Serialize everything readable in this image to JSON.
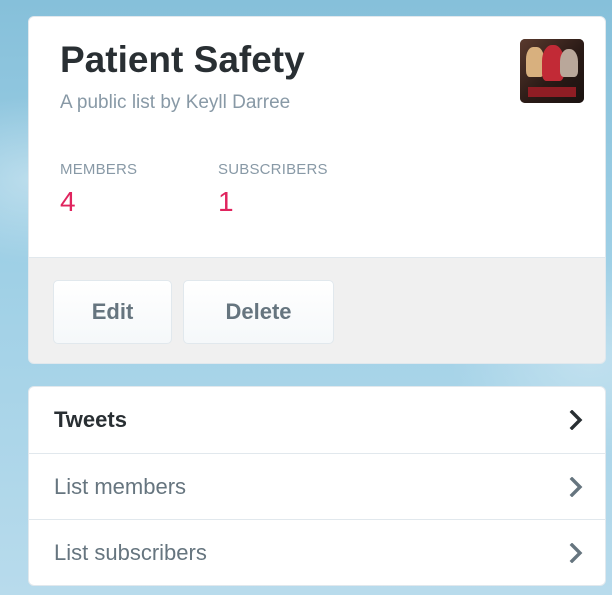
{
  "list": {
    "title": "Patient Safety",
    "byline_prefix": "A public list by",
    "owner_name": "Keyll Darree"
  },
  "stats": {
    "members_label": "MEMBERS",
    "members_value": "4",
    "subscribers_label": "SUBSCRIBERS",
    "subscribers_value": "1"
  },
  "actions": {
    "edit_label": "Edit",
    "delete_label": "Delete"
  },
  "nav": {
    "items": [
      {
        "label": "Tweets",
        "icon": "chevron-right-icon"
      },
      {
        "label": "List members",
        "icon": "chevron-right-icon"
      },
      {
        "label": "List subscribers",
        "icon": "chevron-right-icon"
      }
    ]
  },
  "colors": {
    "stat_value": "#e0245e",
    "title": "#292f33",
    "muted": "#8899a6",
    "background": "#8cc3dc"
  }
}
